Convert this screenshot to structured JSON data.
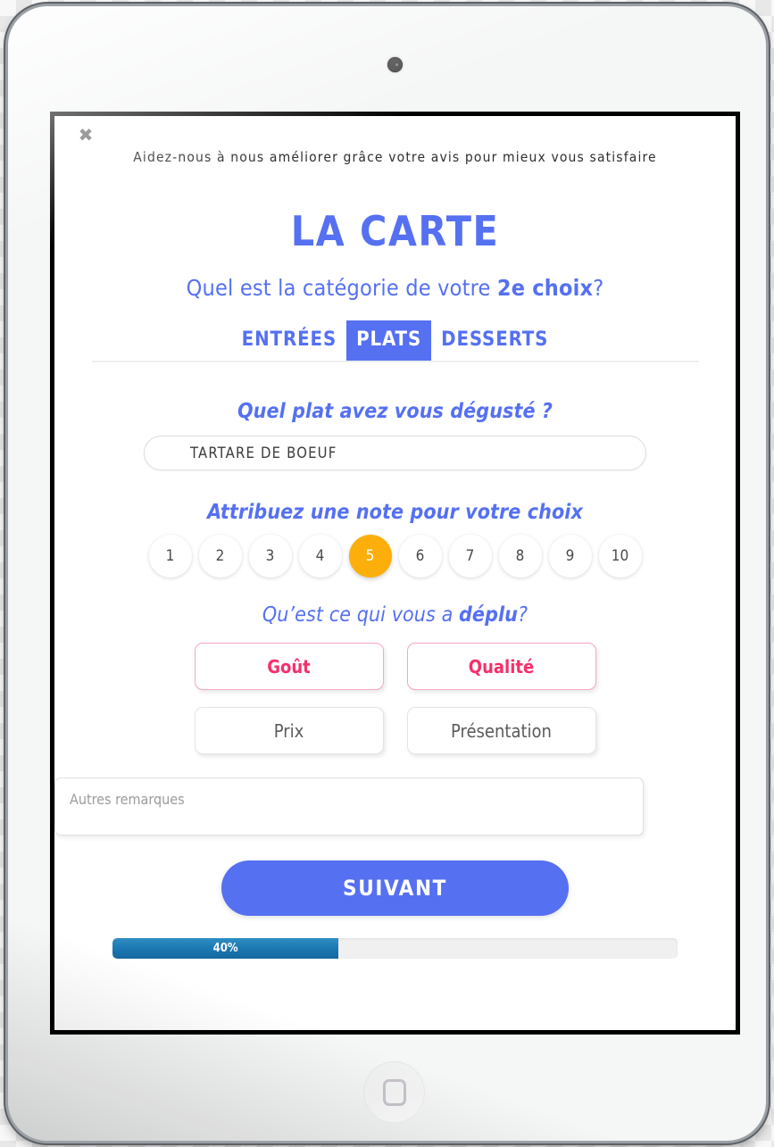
{
  "device": {
    "camera_icon": "camera-dot",
    "home_icon": "home-square-icon"
  },
  "survey": {
    "close_label": "✖",
    "intro": "Aidez-nous à nous améliorer grâce votre avis pour mieux vous satisfaire",
    "title": "LA CARTE",
    "subtitle_prefix": "Quel est la catégorie de votre ",
    "subtitle_highlight": "2e choix",
    "subtitle_suffix": "?",
    "tabs": [
      {
        "label": "ENTRÉES",
        "active": false
      },
      {
        "label": "PLATS",
        "active": true
      },
      {
        "label": "DESSERTS",
        "active": false
      }
    ],
    "dish_question": "Quel plat avez vous dégusté ?",
    "dish_value": "TARTARE DE BOEUF",
    "rating_question": "Attribuez une note pour votre choix",
    "rating_values": [
      "1",
      "2",
      "3",
      "4",
      "5",
      "6",
      "7",
      "8",
      "9",
      "10"
    ],
    "rating_selected": "5",
    "reason_question_prefix": "Qu’est ce qui vous a ",
    "reason_question_highlight": "déplu",
    "reason_question_suffix": "?",
    "reasons": [
      {
        "label": "Goût",
        "selected": true
      },
      {
        "label": "Qualité",
        "selected": true
      },
      {
        "label": "Prix",
        "selected": false
      },
      {
        "label": "Présentation",
        "selected": false
      }
    ],
    "remarks_placeholder": "Autres remarques",
    "remarks_value": "",
    "submit_label": "SUIVANT",
    "progress_percent": 40,
    "progress_label": "40%"
  },
  "colors": {
    "brand_blue": "#5570f1",
    "accent_pink": "#f72e6b",
    "rating_orange": "#fcae0b",
    "progress_blue": "#1a76b0"
  }
}
